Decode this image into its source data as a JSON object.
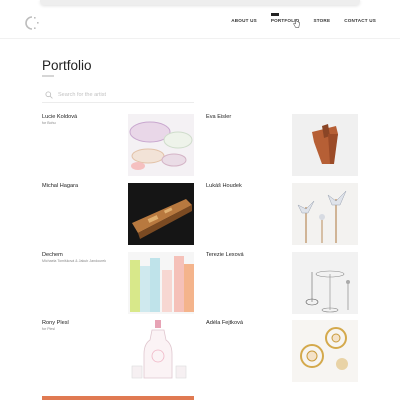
{
  "header": {
    "nav": [
      {
        "label": "ABOUT US"
      },
      {
        "label": "PORTFOLIO"
      },
      {
        "label": "STORE"
      },
      {
        "label": "CONTACT US"
      }
    ]
  },
  "page": {
    "title": "Portfolio",
    "search_placeholder": "Search for the artist"
  },
  "artists": [
    {
      "name": "Lucie Koldová",
      "subtitle": "for Bohu"
    },
    {
      "name": "Eva Eisler",
      "subtitle": ""
    },
    {
      "name": "Michal Hagara",
      "subtitle": ""
    },
    {
      "name": "Lukáš Houdek",
      "subtitle": ""
    },
    {
      "name": "Dechem",
      "subtitle": "Michaela Tomišková & Jakub Jandourek"
    },
    {
      "name": "Terezie Lexová",
      "subtitle": ""
    },
    {
      "name": "Rony Plesl",
      "subtitle": "for Plesl"
    },
    {
      "name": "Adéla Fejtková",
      "subtitle": ""
    }
  ],
  "colors": {
    "accent_bar": "#e07a52"
  }
}
